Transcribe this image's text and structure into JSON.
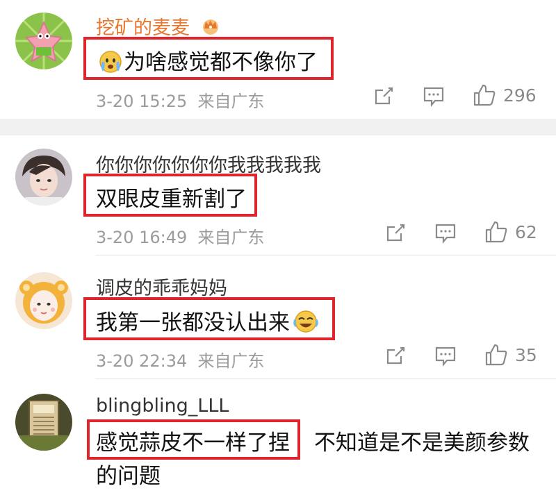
{
  "comments": [
    {
      "username": "挖矿的麦麦",
      "text": "为啥感觉都不像你了",
      "date": "3-20 15:25",
      "source": "来自广东",
      "likes": "296"
    },
    {
      "username": "你你你你你你你我我我我我",
      "text": "双眼皮重新割了",
      "date": "3-20 16:49",
      "source": "来自广东",
      "likes": "62"
    },
    {
      "username": "调皮的乖乖妈妈",
      "text": "我第一张都没认出来",
      "date": "3-20 22:34",
      "source": "来自广东",
      "likes": "35"
    },
    {
      "username": "blingbling_LLL",
      "text": "感觉蒜皮不一样了捏",
      "text_extra": "不知道是不是美颜参数",
      "text_line2": "的问题"
    }
  ],
  "colors": {
    "highlight": "#e0242b",
    "vip_name": "#e8772e",
    "meta": "#9b9b9b"
  },
  "icons": [
    "share-icon",
    "comment-icon",
    "like-icon",
    "crown-icon",
    "emoji-icon"
  ]
}
